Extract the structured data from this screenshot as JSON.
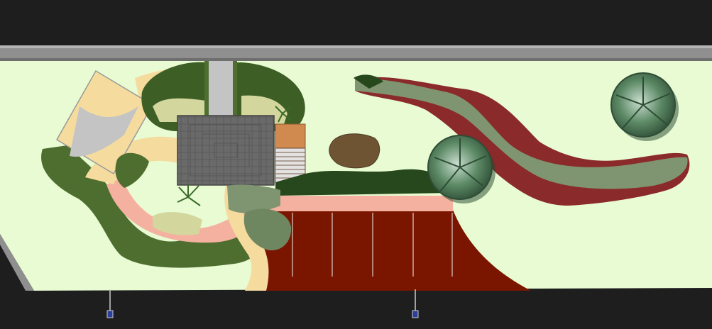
{
  "colors": {
    "background": "#1e1e1e",
    "lawn": "#e8fbd3",
    "wall": "#8f8f8f",
    "driveway": "#7a1600",
    "path_pink": "#f5b1a0",
    "path_tan": "#f5dc9e",
    "patio_gray": "#c4c4c4",
    "roof": "#6a6a6a",
    "hedge_dark": "#27481d",
    "shrub_mid": "#5b7a3b",
    "shrub_light": "#d4d79d",
    "flower_red": "#8a2a2a",
    "sage": "#7f9470",
    "tree_canopy": "#4f7a56",
    "deck": "#d6d6d6",
    "shed_roof": "#d08a50"
  },
  "elements": [
    {
      "name": "boundary-wall",
      "type": "wall"
    },
    {
      "name": "lawn-area",
      "type": "lawn"
    },
    {
      "name": "house-roof",
      "type": "building"
    },
    {
      "name": "shed-roof",
      "type": "building"
    },
    {
      "name": "deck",
      "type": "deck"
    },
    {
      "name": "patio-square",
      "type": "paving"
    },
    {
      "name": "garden-path",
      "type": "path"
    },
    {
      "name": "driveway",
      "type": "driveway"
    },
    {
      "name": "flower-bed-sweep",
      "type": "planting"
    },
    {
      "name": "specimen-tree-left",
      "type": "tree"
    },
    {
      "name": "specimen-tree-right",
      "type": "tree"
    },
    {
      "name": "brown-shrub-clump",
      "type": "planting"
    },
    {
      "name": "street-light-left",
      "type": "fixture"
    },
    {
      "name": "street-light-right",
      "type": "fixture"
    }
  ]
}
